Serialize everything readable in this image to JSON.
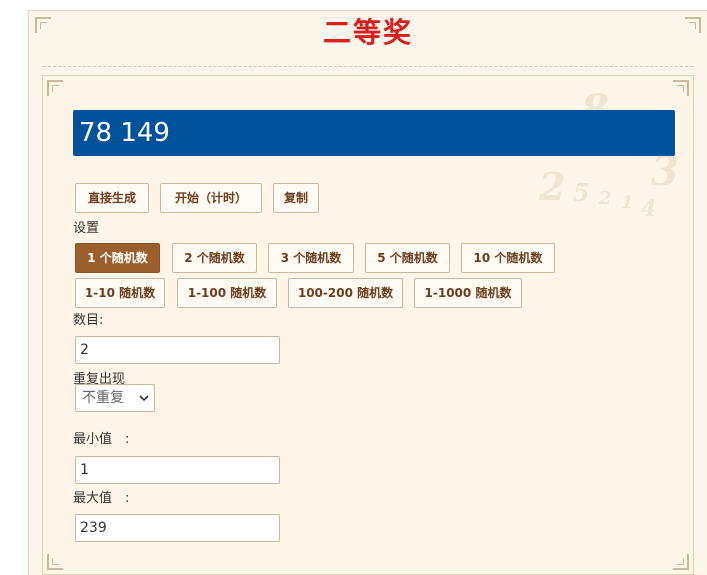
{
  "title": "二等奖",
  "result": "78 149",
  "actions": {
    "generate": "直接生成",
    "start": "开始（计时）",
    "copy": "复制"
  },
  "settings": {
    "label": "设置",
    "presets_row1": [
      "1 个随机数",
      "2 个随机数",
      "3 个随机数",
      "5 个随机数",
      "10 个随机数"
    ],
    "presets_row2": [
      "1-10 随机数",
      "1-100 随机数",
      "100-200 随机数",
      "1-1000 随机数"
    ],
    "active_preset": "1 个随机数"
  },
  "count": {
    "label": "数目:",
    "value": "2"
  },
  "repeat": {
    "label": "重复出现",
    "selected": "不重复"
  },
  "min": {
    "label": "最小值　:",
    "value": "1"
  },
  "max": {
    "label": "最大值　:",
    "value": "239"
  },
  "colors": {
    "title": "#d81e1e",
    "result_bg": "#00529b",
    "active_button": "#9a5f2d",
    "panel_bg": "#fcf5e8"
  }
}
